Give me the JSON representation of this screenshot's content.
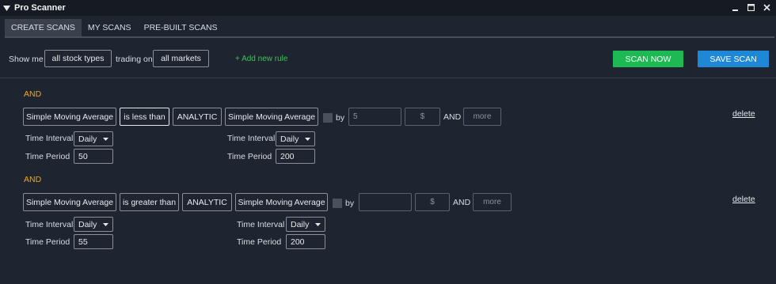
{
  "window": {
    "title": "Pro Scanner",
    "icons": {
      "app": "dropdown-triangle-icon",
      "minimize": "minimize-icon",
      "maximize": "maximize-icon",
      "close": "close-icon"
    }
  },
  "tabs": [
    {
      "label": "CREATE SCANS",
      "active": true
    },
    {
      "label": "MY SCANS",
      "active": false
    },
    {
      "label": "PRE-BUILT SCANS",
      "active": false
    }
  ],
  "toolbar": {
    "show_me": "Show me",
    "stock_types": "all stock types",
    "trading_on": "trading on",
    "markets": "all markets",
    "add_rule": "+ Add new rule",
    "scan_now": "SCAN NOW",
    "save_scan": "SAVE SCAN"
  },
  "colors": {
    "background": "#1f2530",
    "scan_now": "#1db954",
    "save_scan": "#1e88d6",
    "and_label": "#e6a82a",
    "add_rule": "#3ec15a"
  },
  "rules": [
    {
      "and_label": "AND",
      "indicator_left": "Simple Moving Average",
      "comparator": "is less than",
      "analytic": "ANALYTIC",
      "indicator_right": "Simple Moving Average",
      "by_label": "by",
      "by_value": "5",
      "unit": "$",
      "and2": "AND",
      "more": "more",
      "delete": "delete",
      "left": {
        "interval_label": "Time Interval",
        "interval": "Daily",
        "period_label": "Time Period",
        "period": "50"
      },
      "right": {
        "interval_label": "Time Interval",
        "interval": "Daily",
        "period_label": "Time Period",
        "period": "200"
      }
    },
    {
      "and_label": "AND",
      "indicator_left": "Simple Moving Average",
      "comparator": "is greater than",
      "analytic": "ANALYTIC",
      "indicator_right": "Simple Moving Average",
      "by_label": "by",
      "by_value": "",
      "unit": "$",
      "and2": "AND",
      "more": "more",
      "delete": "delete",
      "left": {
        "interval_label": "Time Interval",
        "interval": "Daily",
        "period_label": "Time Period",
        "period": "55"
      },
      "right": {
        "interval_label": "Time Interval",
        "interval": "Daily",
        "period_label": "Time Period",
        "period": "200"
      }
    }
  ]
}
